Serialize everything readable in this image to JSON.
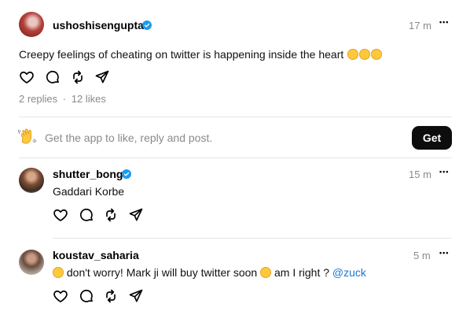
{
  "post": {
    "username": "ushoshisengupta",
    "time": "17 m",
    "more": "•••",
    "text": "Creepy feelings of cheating on twitter is happening inside the heart",
    "emojis": [
      "grinning-squinting-face",
      "rolling-on-floor-laughing",
      "grinning-squinting-face"
    ],
    "replies": "2 replies",
    "separator": "·",
    "likes": "12 likes"
  },
  "app_banner": {
    "wave_icon": "waving-hand-icon",
    "text": "Get the app to like, reply and post.",
    "button": "Get"
  },
  "replies": [
    {
      "username": "shutter_bong",
      "verified": true,
      "time": "15 m",
      "more": "•••",
      "text": "Gaddari Korbe"
    },
    {
      "username": "koustav_saharia",
      "verified": false,
      "time": "5 m",
      "more": "•••",
      "text_before": " don't worry! Mark ji will buy twitter soon ",
      "text_after": " am I right ? ",
      "mention": "@zuck"
    }
  ],
  "colors": {
    "verified": "#1d9bf0",
    "mention": "#1c76d2",
    "muted": "#8a8a8a",
    "button_bg": "#0d0d0d"
  }
}
